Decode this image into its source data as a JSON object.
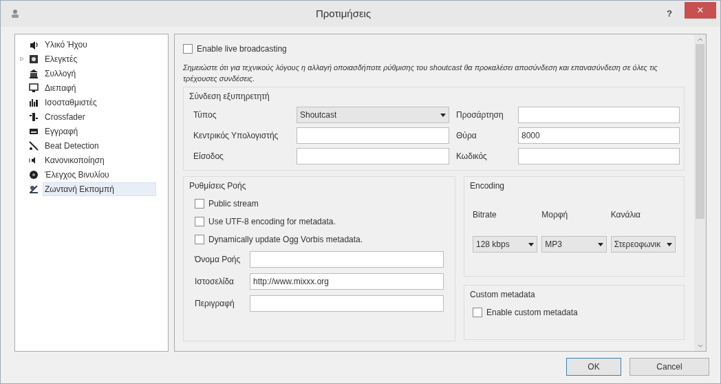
{
  "window": {
    "title": "Προτιμήσεις",
    "help": "?",
    "close": "×"
  },
  "sidebar": {
    "items": [
      {
        "label": "Υλικό Ήχου",
        "selected": false
      },
      {
        "label": "Ελεγκτές",
        "selected": false,
        "expanded": false
      },
      {
        "label": "Συλλογή",
        "selected": false
      },
      {
        "label": "Διεπαφή",
        "selected": false
      },
      {
        "label": "Ισοσταθμιστές",
        "selected": false
      },
      {
        "label": "Crossfader",
        "selected": false
      },
      {
        "label": "Εγγραφή",
        "selected": false
      },
      {
        "label": "Beat Detection",
        "selected": false
      },
      {
        "label": "Κανονικοποίηση",
        "selected": false
      },
      {
        "label": "Έλεγχος Βινυλίου",
        "selected": false
      },
      {
        "label": "Ζωντανή Εκπομπή",
        "selected": true
      }
    ]
  },
  "enable_broadcasting": {
    "label": "Enable live broadcasting",
    "checked": false
  },
  "note": "Σημειώστε ότι για τεχνικούς λόγους η αλλαγή οποιασδήποτε ρύθμισης του shoutcast θα προκαλέσει αποσύνδεση και επανασύνδεση σε όλες τις τρέχουσες συνδέσεις.",
  "server_connection": {
    "title": "Σύνδεση εξυπηρετητή",
    "rows": [
      [
        {
          "label": "Τύπος",
          "kind": "dropdown",
          "value": "Shoutcast"
        },
        {
          "label": "Προσάρτηση",
          "kind": "text"
        }
      ],
      [
        {
          "label": "Κεντρικός Υπολογιστής",
          "kind": "text"
        },
        {
          "label": "Θύρα",
          "kind": "text",
          "value": "8000"
        }
      ],
      [
        {
          "label": "Είσοδος",
          "kind": "text"
        },
        {
          "label": "Κωδικός",
          "kind": "text"
        }
      ]
    ]
  },
  "stream_settings": {
    "title": "Ρυθμίσεις Ροής",
    "checkboxes": [
      {
        "label": "Public stream",
        "checked": false
      },
      {
        "label": "Use UTF-8 encoding for metadata.",
        "checked": false
      },
      {
        "label": "Dynamically update Ogg Vorbis metadata.",
        "checked": false
      }
    ],
    "fields": [
      {
        "label": "Όνομα Ροής"
      },
      {
        "label": "Ιστοσελίδα",
        "value": "http://www.mixxx.org"
      },
      {
        "label": "Περιγραφή"
      }
    ]
  },
  "encoding": {
    "title": "Encoding",
    "columns": [
      {
        "label": "Bitrate",
        "value": "128 kbps"
      },
      {
        "label": "Μορφή",
        "value": "MP3"
      },
      {
        "label": "Κανάλια",
        "value": "Στερεοφωνικ"
      }
    ]
  },
  "custom_metadata": {
    "title": "Custom metadata",
    "checkbox": {
      "label": "Enable custom metadata",
      "checked": false
    }
  },
  "buttons": [
    {
      "label": "OK",
      "default": true
    },
    {
      "label": "Cancel",
      "default": false
    }
  ]
}
